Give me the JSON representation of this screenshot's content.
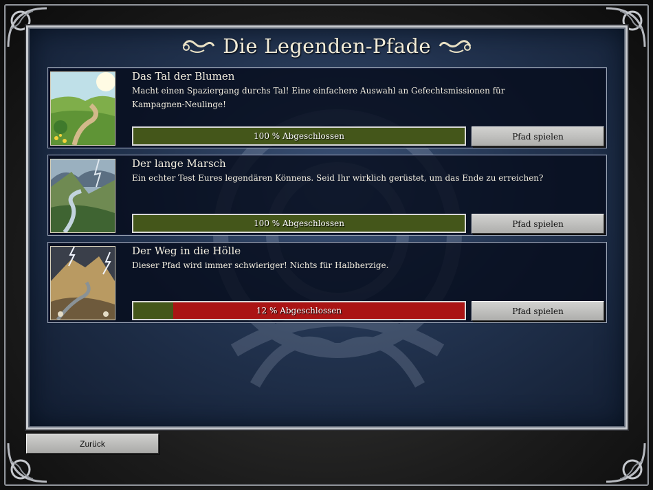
{
  "header": {
    "title": "Die Legenden-Pfade"
  },
  "colors": {
    "panel_blue": "#22334f",
    "progress_complete": "#44561a",
    "progress_remaining": "#aa1414",
    "button_face": "#c0c0be",
    "frame_silver": "#c9ccd1"
  },
  "paths": [
    {
      "title": "Das Tal der Blumen",
      "description": "Macht einen Spaziergang durchs Tal! Eine einfachere Auswahl an Gefechtsmissionen für Kampagnen-Neulinge!",
      "progress_percent": 100,
      "progress_text": "100 % Abgeschlossen",
      "button_label": "Pfad spielen",
      "thumbnail": "green-valley-path-image"
    },
    {
      "title": "Der lange Marsch",
      "description": "Ein echter Test Eures legendären Könnens. Seid Ihr wirklich gerüstet, um das Ende zu erreichen?",
      "progress_percent": 100,
      "progress_text": "100 % Abgeschlossen",
      "button_label": "Pfad spielen",
      "thumbnail": "mountain-river-valley-image"
    },
    {
      "title": "Der Weg in die Hölle",
      "description": "Dieser Pfad wird immer schwieriger! Nichts für Halbherzige.",
      "progress_percent": 12,
      "progress_text": "12 % Abgeschlossen",
      "button_label": "Pfad spielen",
      "thumbnail": "volcanic-mountain-lightning-image"
    }
  ],
  "footer": {
    "back_label": "Zurück"
  }
}
